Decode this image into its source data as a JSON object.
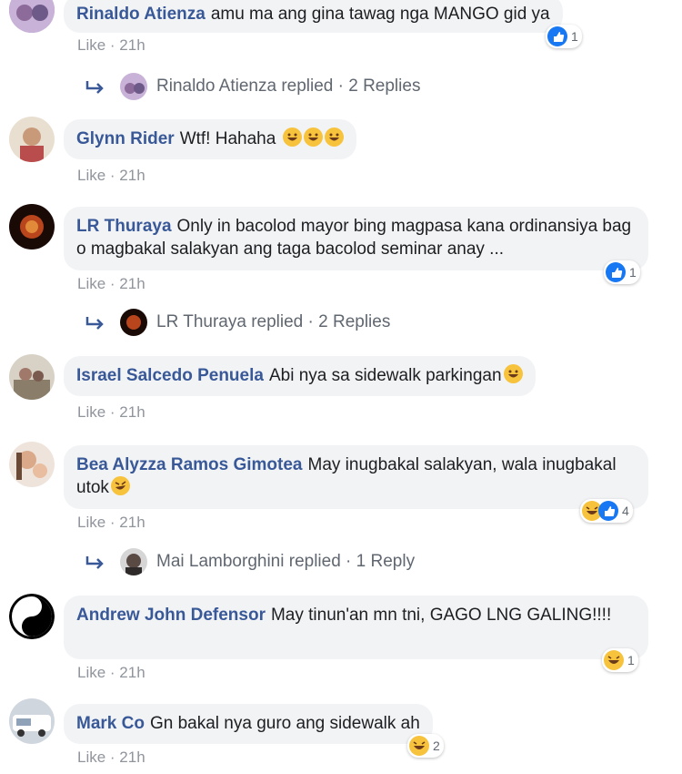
{
  "meta_like_label": "Like · 21h",
  "comments": [
    {
      "name": "Rinaldo Atienza",
      "text": "amu ma ang gina tawag nga MANGO gid ya",
      "reaction_count": "1",
      "reaction_icons": [
        "like-icon"
      ]
    },
    {
      "name": "Glynn Rider",
      "text": "Wtf! Hahaha",
      "emoji_count": 3
    },
    {
      "name": "LR Thuraya",
      "text": "Only in bacolod mayor bing magpasa kana ordinansiya bag o magbakal salakyan ang taga bacolod seminar anay ...",
      "reaction_count": "1",
      "reaction_icons": [
        "like-icon"
      ]
    },
    {
      "name": "Israel Salcedo Penuela",
      "text": "Abi nya sa sidewalk parkingan"
    },
    {
      "name": "Bea Alyzza Ramos Gimotea",
      "text": "May inugbakal salakyan, wala inugbakal utok",
      "reaction_count": "4",
      "reaction_icons": [
        "haha-icon",
        "like-icon"
      ]
    },
    {
      "name": "Andrew John Defensor",
      "text": "May tinun'an mn tni, GAGO LNG GALING!!!!",
      "reaction_count": "1",
      "reaction_icons": [
        "haha-icon"
      ]
    },
    {
      "name": "Mark Co",
      "text": "Gn bakal nya guro ang sidewalk ah",
      "reaction_count": "2",
      "reaction_icons": [
        "haha-icon"
      ]
    }
  ],
  "replies": [
    {
      "text": "Rinaldo Atienza replied · 2 Replies"
    },
    {
      "text": "LR Thuraya replied · 2 Replies"
    },
    {
      "text": "Mai Lamborghini replied · 1 Reply"
    }
  ],
  "colors": {
    "name": "#385898",
    "bubble": "#f2f3f5",
    "meta": "#90949c",
    "like_blue": "#1877f2",
    "haha_yellow": "#f7c33c"
  }
}
